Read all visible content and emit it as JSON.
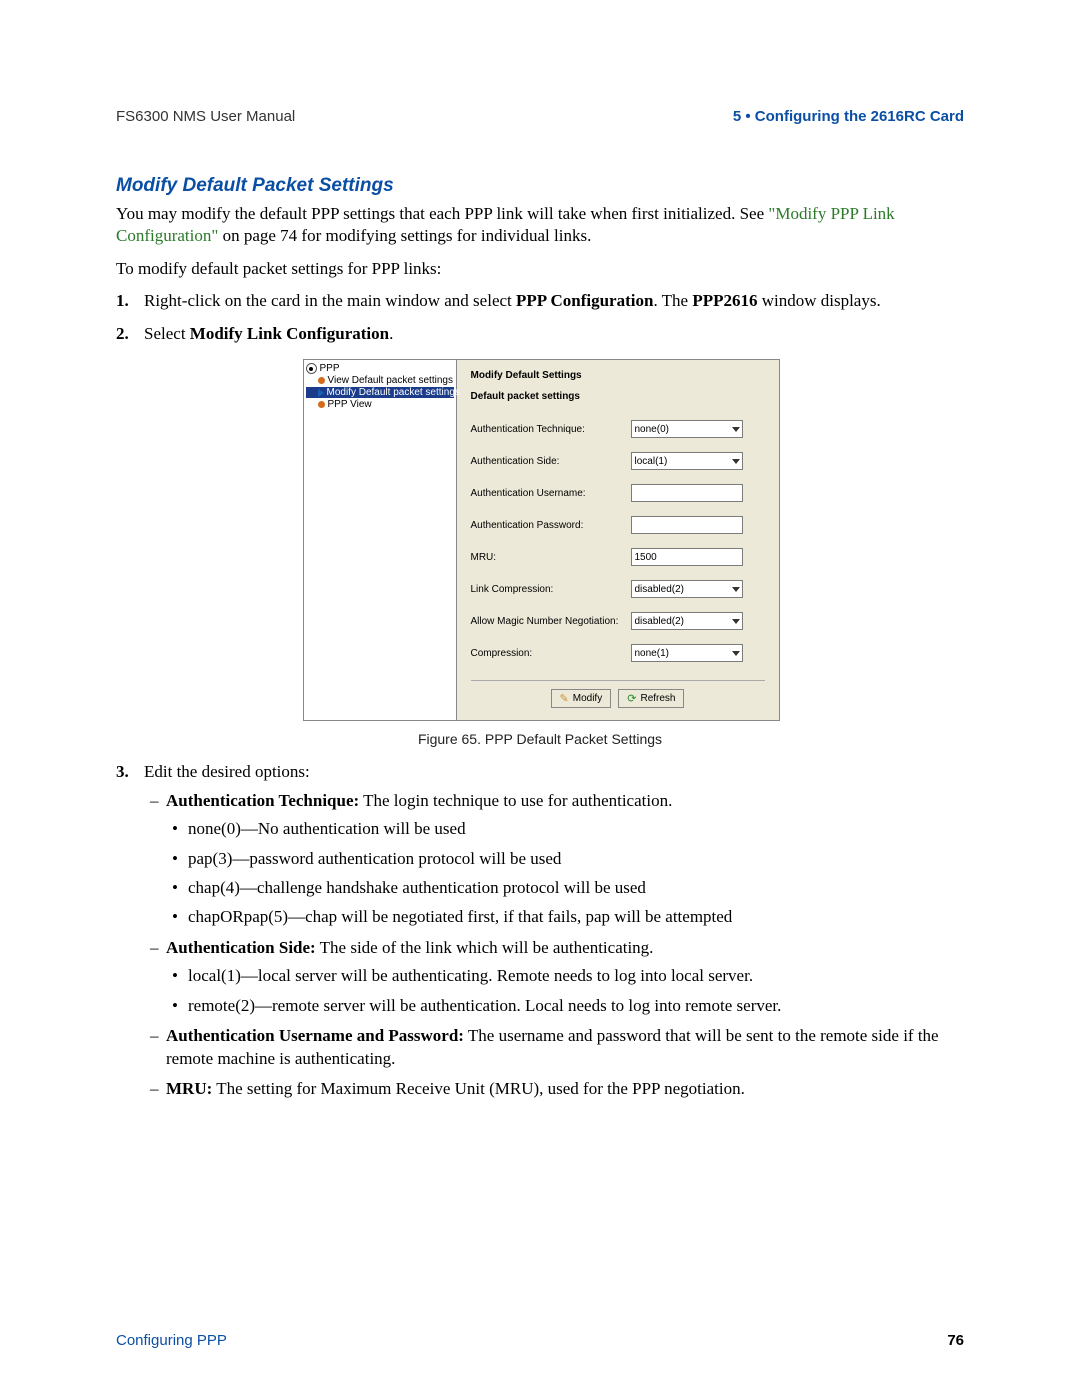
{
  "header": {
    "left": "FS6300 NMS User Manual",
    "right": "5 • Configuring the 2616RC Card"
  },
  "section_heading": "Modify Default Packet Settings",
  "intro": {
    "pre": "You may modify the default PPP settings that each PPP link will take when first initialized. See ",
    "link": "\"Modify PPP Link Configuration\"",
    "post": " on page 74 for modifying settings for individual links."
  },
  "lead": "To modify default packet settings for PPP links:",
  "step1": {
    "num": "1.",
    "pre": "Right-click on the card in the main window and select ",
    "bold1": "PPP Configuration",
    "mid": ". The ",
    "bold2": "PPP2616",
    "post": " window displays."
  },
  "step2": {
    "num": "2.",
    "pre": "Select ",
    "bold": "Modify Link Configuration",
    "post": "."
  },
  "screenshot": {
    "tree": {
      "root": "PPP",
      "items": [
        "View Default packet settings",
        "Modify Default packet settings",
        "PPP View"
      ],
      "selected_index": 1
    },
    "panel_title": "Modify Default Settings",
    "panel_subtitle": "Default packet settings",
    "fields": [
      {
        "label": "Authentication Technique:",
        "value": "none(0)",
        "type": "select"
      },
      {
        "label": "Authentication Side:",
        "value": "local(1)",
        "type": "select"
      },
      {
        "label": "Authentication Username:",
        "value": "",
        "type": "text"
      },
      {
        "label": "Authentication Password:",
        "value": "",
        "type": "text"
      },
      {
        "label": "MRU:",
        "value": "1500",
        "type": "text"
      },
      {
        "label": "Link Compression:",
        "value": "disabled(2)",
        "type": "select"
      },
      {
        "label": "Allow Magic Number Negotiation:",
        "value": "disabled(2)",
        "type": "select"
      },
      {
        "label": "Compression:",
        "value": "none(1)",
        "type": "select"
      }
    ],
    "buttons": {
      "modify": "Modify",
      "refresh": "Refresh"
    }
  },
  "figure_caption": "Figure 65. PPP Default Packet Settings",
  "step3": {
    "num": "3.",
    "text": "Edit the desired options:",
    "items": [
      {
        "bold": "Authentication Technique:",
        "rest": " The login technique to use for authentication.",
        "bullets": [
          "none(0)—No authentication will be used",
          "pap(3)—password authentication protocol will be used",
          "chap(4)—challenge handshake authentication protocol will be used",
          "chapORpap(5)—chap will be negotiated first, if that fails, pap will be attempted"
        ]
      },
      {
        "bold": "Authentication Side:",
        "rest": " The side of the link which will be authenticating.",
        "bullets": [
          "local(1)—local server will be authenticating. Remote needs to log into local server.",
          "remote(2)—remote server will be authentication. Local needs to log into remote server."
        ]
      },
      {
        "bold": "Authentication Username and Password:",
        "rest": " The username and password that will be sent to the remote side if the remote machine is authenticating."
      },
      {
        "bold": "MRU:",
        "rest": " The setting for Maximum Receive Unit (MRU), used for the PPP negotiation."
      }
    ]
  },
  "footer": {
    "left": "Configuring PPP",
    "right": "76"
  }
}
